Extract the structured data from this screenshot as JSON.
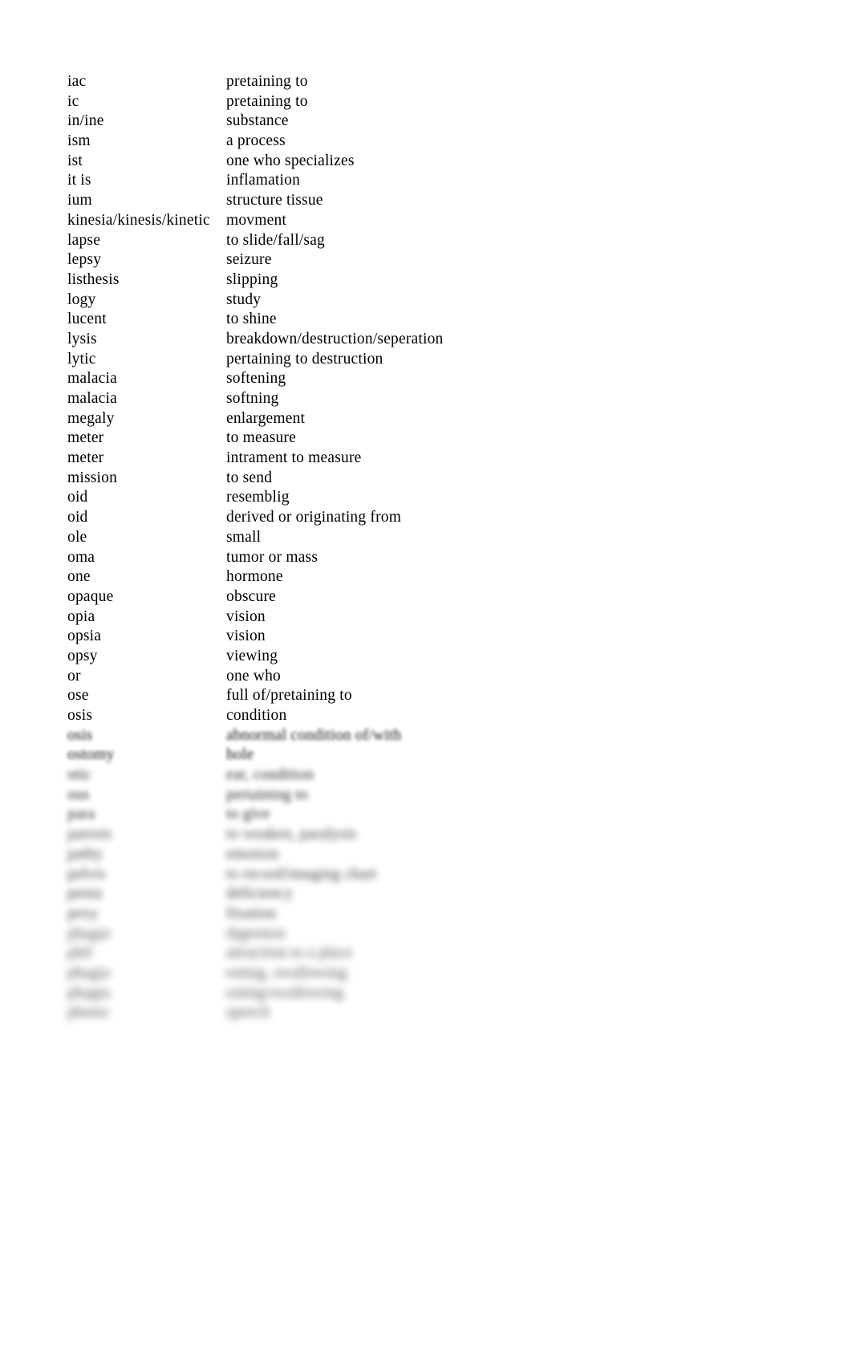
{
  "document": {
    "kind": "glossary",
    "background_color": "#ffffff",
    "text_color": "#000000",
    "columns": [
      "term",
      "definition"
    ],
    "rows": [
      {
        "term": "iac",
        "definition": "pretaining to",
        "legible": true
      },
      {
        "term": "ic",
        "definition": "pretaining to",
        "legible": true
      },
      {
        "term": "in/ine",
        "definition": "substance",
        "legible": true
      },
      {
        "term": "ism",
        "definition": "a process",
        "legible": true
      },
      {
        "term": "ist",
        "definition": "one who specializes",
        "legible": true
      },
      {
        "term": "it is",
        "definition": "inflamation",
        "legible": true
      },
      {
        "term": "ium",
        "definition": "structure tissue",
        "legible": true
      },
      {
        "term": "kinesia/kinesis/kinetic",
        "definition": "movment",
        "legible": true
      },
      {
        "term": "lapse",
        "definition": "to slide/fall/sag",
        "legible": true
      },
      {
        "term": "lepsy",
        "definition": "seizure",
        "legible": true
      },
      {
        "term": "listhesis",
        "definition": "slipping",
        "legible": true
      },
      {
        "term": "logy",
        "definition": "study",
        "legible": true
      },
      {
        "term": "lucent",
        "definition": "to shine",
        "legible": true
      },
      {
        "term": "lysis",
        "definition": "breakdown/destruction/seperation",
        "legible": true
      },
      {
        "term": "lytic",
        "definition": "pertaining to destruction",
        "legible": true
      },
      {
        "term": "malacia",
        "definition": "softening",
        "legible": true
      },
      {
        "term": "malacia",
        "definition": "softning",
        "legible": true
      },
      {
        "term": "megaly",
        "definition": "enlargement",
        "legible": true
      },
      {
        "term": "meter",
        "definition": "to measure",
        "legible": true
      },
      {
        "term": "meter",
        "definition": "intrament to measure",
        "legible": true
      },
      {
        "term": "mission",
        "definition": "to send",
        "legible": true
      },
      {
        "term": "oid",
        "definition": "resemblig",
        "legible": true
      },
      {
        "term": "oid",
        "definition": "derived or originating from",
        "legible": true
      },
      {
        "term": "ole",
        "definition": "small",
        "legible": true
      },
      {
        "term": "oma",
        "definition": "tumor or mass",
        "legible": true
      },
      {
        "term": "one",
        "definition": "hormone",
        "legible": true
      },
      {
        "term": "opaque",
        "definition": "obscure",
        "legible": true
      },
      {
        "term": "opia",
        "definition": "vision",
        "legible": true
      },
      {
        "term": "opsia",
        "definition": "vision",
        "legible": true
      },
      {
        "term": "opsy",
        "definition": "viewing",
        "legible": true
      },
      {
        "term": "or",
        "definition": "one who",
        "legible": true
      },
      {
        "term": "ose",
        "definition": "full of/pretaining to",
        "legible": true
      },
      {
        "term": "osis",
        "definition": "condition",
        "legible": true
      },
      {
        "term": "osis",
        "definition": "abnormal condition of/with",
        "legible": false,
        "redaction": 1
      },
      {
        "term": "ostomy",
        "definition": "hole",
        "legible": false,
        "redaction": 1
      },
      {
        "term": "otic",
        "definition": "ear, condition",
        "legible": false,
        "redaction": 2
      },
      {
        "term": "ous",
        "definition": "pertaining to",
        "legible": false,
        "redaction": 2
      },
      {
        "term": "para",
        "definition": "to give",
        "legible": false,
        "redaction": 2
      },
      {
        "term": "paresis",
        "definition": "to weaken, paralysis",
        "legible": false,
        "redaction": 3
      },
      {
        "term": "pathy",
        "definition": "emotion",
        "legible": false,
        "redaction": 3
      },
      {
        "term": "pelvis",
        "definition": "to record/imaging chart",
        "legible": false,
        "redaction": 3
      },
      {
        "term": "penia",
        "definition": "deficiency",
        "legible": false,
        "redaction": 3
      },
      {
        "term": "pexy",
        "definition": "fixation",
        "legible": false,
        "redaction": 3
      },
      {
        "term": "phagia",
        "definition": "digestion",
        "legible": false,
        "redaction": 4
      },
      {
        "term": "phil",
        "definition": "attraction to a place",
        "legible": false,
        "redaction": 4
      },
      {
        "term": "phagia",
        "definition": "eating, swallowing",
        "legible": false,
        "redaction": 4
      },
      {
        "term": "phagia",
        "definition": "eating/swallowing",
        "legible": false,
        "redaction": 4
      },
      {
        "term": "phasia",
        "definition": "speech",
        "legible": false,
        "redaction": 4
      }
    ]
  }
}
